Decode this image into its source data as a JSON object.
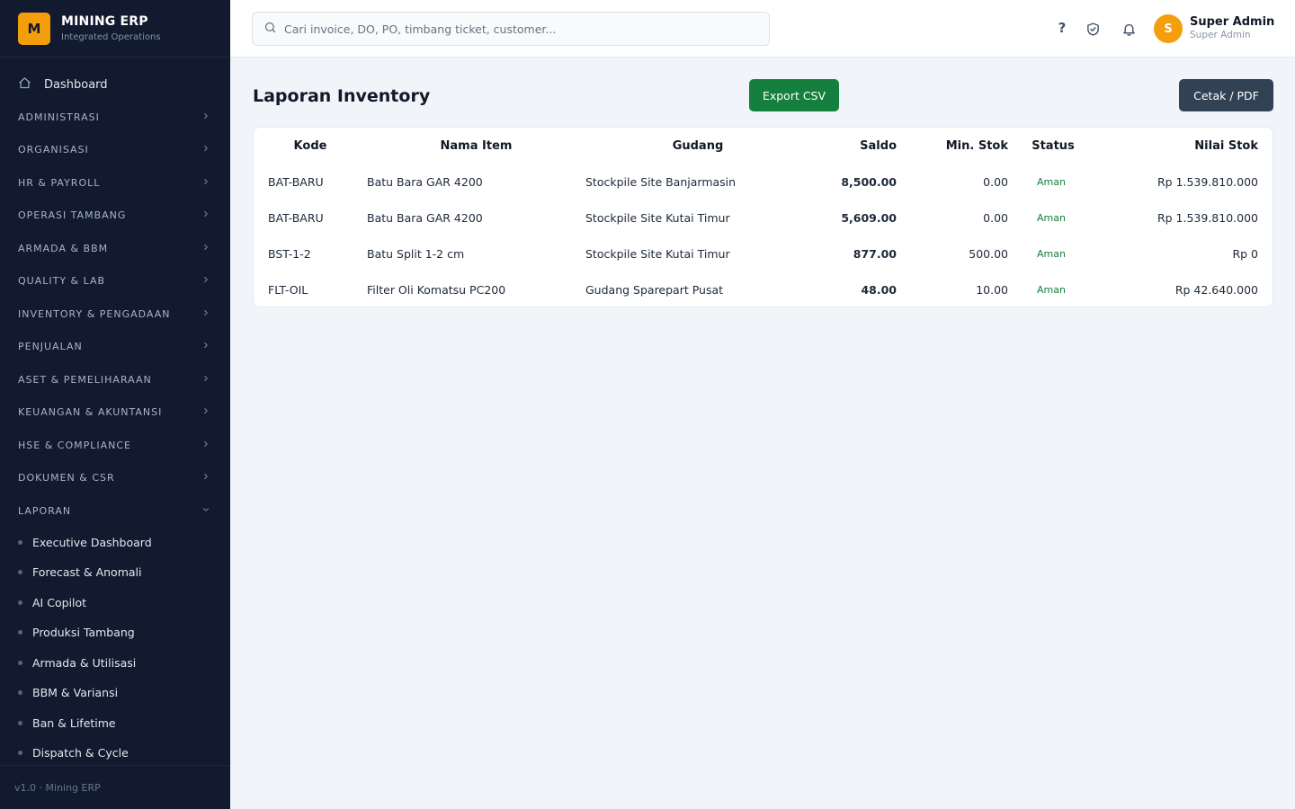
{
  "brand": {
    "logo": "M",
    "name": "MINING ERP",
    "subtitle": "Integrated Operations"
  },
  "sidebar": {
    "dashboard": {
      "label": "Dashboard",
      "icon": "home-icon"
    },
    "sections": [
      {
        "label": "ADMINISTRASI",
        "expanded": false
      },
      {
        "label": "ORGANISASI",
        "expanded": false
      },
      {
        "label": "HR & PAYROLL",
        "expanded": false
      },
      {
        "label": "OPERASI TAMBANG",
        "expanded": false
      },
      {
        "label": "ARMADA & BBM",
        "expanded": false
      },
      {
        "label": "QUALITY & LAB",
        "expanded": false
      },
      {
        "label": "INVENTORY & PENGADAAN",
        "expanded": false
      },
      {
        "label": "PENJUALAN",
        "expanded": false
      },
      {
        "label": "ASET & PEMELIHARAAN",
        "expanded": false
      },
      {
        "label": "KEUANGAN & AKUNTANSI",
        "expanded": false
      },
      {
        "label": "HSE & COMPLIANCE",
        "expanded": false
      },
      {
        "label": "DOKUMEN & CSR",
        "expanded": false
      },
      {
        "label": "LAPORAN",
        "expanded": true
      }
    ],
    "laporan_items": [
      "Executive Dashboard",
      "Forecast & Anomali",
      "AI Copilot",
      "Produksi Tambang",
      "Armada & Utilisasi",
      "BBM & Variansi",
      "Ban & Lifetime",
      "Dispatch & Cycle"
    ],
    "footer": "v1.0 · Mining ERP"
  },
  "header": {
    "search_placeholder": "Cari invoice, DO, PO, timbang ticket, customer...",
    "help_label": "?",
    "user_initial": "S",
    "user_name": "Super Admin",
    "user_role": "Super Admin"
  },
  "page": {
    "title": "Laporan Inventory",
    "export_label": "Export CSV",
    "print_label": "Cetak / PDF"
  },
  "table": {
    "columns": [
      "Kode",
      "Nama Item",
      "Gudang",
      "Saldo",
      "Min. Stok",
      "Status",
      "Nilai Stok"
    ],
    "rows": [
      [
        "BAT-BARU",
        "Batu Bara GAR 4200",
        "Stockpile Site Banjarmasin",
        "8,500.00",
        "0.00",
        "Aman",
        "Rp 1.539.810.000"
      ],
      [
        "BAT-BARU",
        "Batu Bara GAR 4200",
        "Stockpile Site Kutai Timur",
        "5,609.00",
        "0.00",
        "Aman",
        "Rp 1.539.810.000"
      ],
      [
        "BST-1-2",
        "Batu Split 1-2 cm",
        "Stockpile Site Kutai Timur",
        "877.00",
        "500.00",
        "Aman",
        "Rp 0"
      ],
      [
        "FLT-OIL",
        "Filter Oli Komatsu PC200",
        "Gudang Sparepart Pusat",
        "48.00",
        "10.00",
        "Aman",
        "Rp 42.640.000"
      ]
    ]
  },
  "colors": {
    "sidebar_bg": "#111a2e",
    "accent": "#f59e0b",
    "export_button": "#15803d",
    "print_button": "#334155",
    "status_ok": "#15803d"
  }
}
